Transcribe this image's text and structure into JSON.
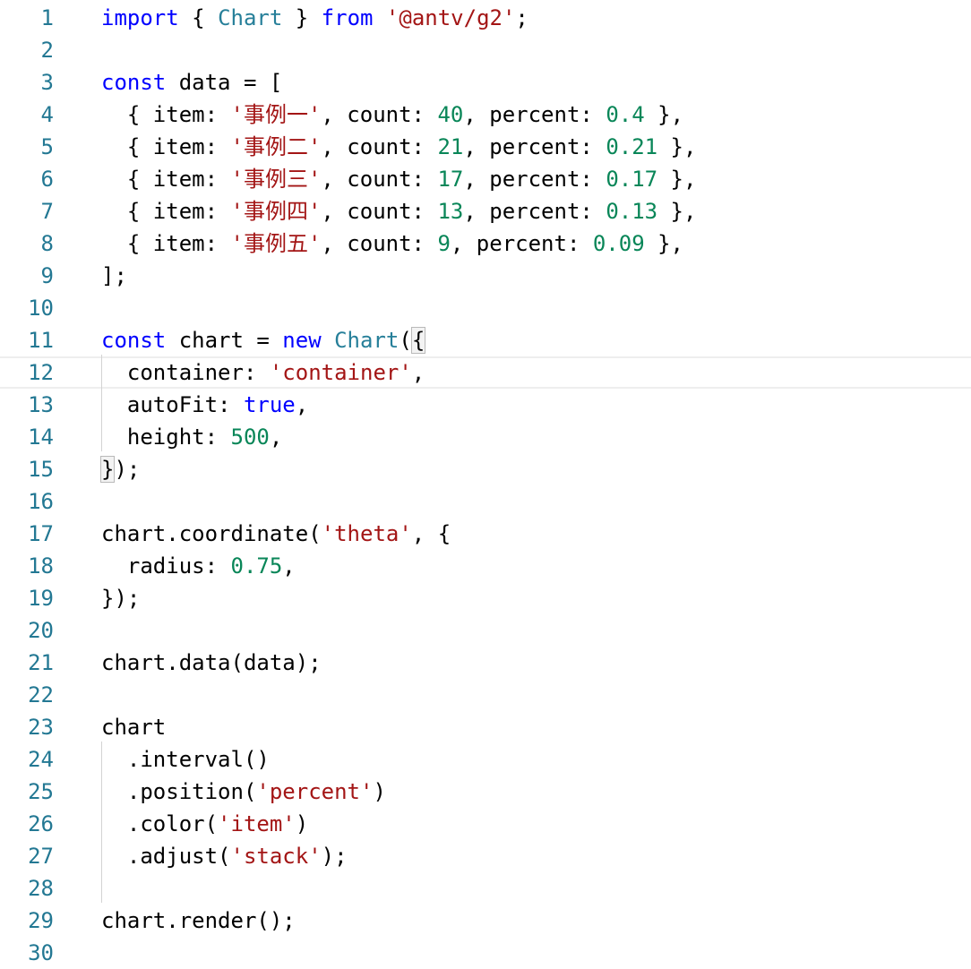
{
  "editor": {
    "lines": [
      {
        "n": "1",
        "tokens": [
          {
            "t": "import",
            "c": "kw"
          },
          {
            "t": " { ",
            "c": "df"
          },
          {
            "t": "Chart",
            "c": "ty"
          },
          {
            "t": " } ",
            "c": "df"
          },
          {
            "t": "from",
            "c": "kw"
          },
          {
            "t": " ",
            "c": "df"
          },
          {
            "t": "'@antv/g2'",
            "c": "st"
          },
          {
            "t": ";",
            "c": "df"
          }
        ]
      },
      {
        "n": "2",
        "tokens": []
      },
      {
        "n": "3",
        "tokens": [
          {
            "t": "const",
            "c": "kw"
          },
          {
            "t": " data = [",
            "c": "df"
          }
        ]
      },
      {
        "n": "4",
        "tokens": [
          {
            "t": "  { item: ",
            "c": "df"
          },
          {
            "t": "'事例一'",
            "c": "st"
          },
          {
            "t": ", count: ",
            "c": "df"
          },
          {
            "t": "40",
            "c": "nm"
          },
          {
            "t": ", percent: ",
            "c": "df"
          },
          {
            "t": "0.4",
            "c": "nm"
          },
          {
            "t": " },",
            "c": "df"
          }
        ]
      },
      {
        "n": "5",
        "tokens": [
          {
            "t": "  { item: ",
            "c": "df"
          },
          {
            "t": "'事例二'",
            "c": "st"
          },
          {
            "t": ", count: ",
            "c": "df"
          },
          {
            "t": "21",
            "c": "nm"
          },
          {
            "t": ", percent: ",
            "c": "df"
          },
          {
            "t": "0.21",
            "c": "nm"
          },
          {
            "t": " },",
            "c": "df"
          }
        ]
      },
      {
        "n": "6",
        "tokens": [
          {
            "t": "  { item: ",
            "c": "df"
          },
          {
            "t": "'事例三'",
            "c": "st"
          },
          {
            "t": ", count: ",
            "c": "df"
          },
          {
            "t": "17",
            "c": "nm"
          },
          {
            "t": ", percent: ",
            "c": "df"
          },
          {
            "t": "0.17",
            "c": "nm"
          },
          {
            "t": " },",
            "c": "df"
          }
        ]
      },
      {
        "n": "7",
        "tokens": [
          {
            "t": "  { item: ",
            "c": "df"
          },
          {
            "t": "'事例四'",
            "c": "st"
          },
          {
            "t": ", count: ",
            "c": "df"
          },
          {
            "t": "13",
            "c": "nm"
          },
          {
            "t": ", percent: ",
            "c": "df"
          },
          {
            "t": "0.13",
            "c": "nm"
          },
          {
            "t": " },",
            "c": "df"
          }
        ]
      },
      {
        "n": "8",
        "tokens": [
          {
            "t": "  { item: ",
            "c": "df"
          },
          {
            "t": "'事例五'",
            "c": "st"
          },
          {
            "t": ", count: ",
            "c": "df"
          },
          {
            "t": "9",
            "c": "nm"
          },
          {
            "t": ", percent: ",
            "c": "df"
          },
          {
            "t": "0.09",
            "c": "nm"
          },
          {
            "t": " },",
            "c": "df"
          }
        ]
      },
      {
        "n": "9",
        "tokens": [
          {
            "t": "];",
            "c": "df"
          }
        ]
      },
      {
        "n": "10",
        "tokens": []
      },
      {
        "n": "11",
        "tokens": [
          {
            "t": "const",
            "c": "kw"
          },
          {
            "t": " chart = ",
            "c": "df"
          },
          {
            "t": "new",
            "c": "kw"
          },
          {
            "t": " ",
            "c": "df"
          },
          {
            "t": "Chart",
            "c": "ty"
          },
          {
            "t": "(",
            "c": "df"
          },
          {
            "t": "{",
            "c": "df",
            "m": true
          }
        ]
      },
      {
        "n": "12",
        "tokens": [
          {
            "t": "  container: ",
            "c": "df"
          },
          {
            "t": "'container'",
            "c": "st"
          },
          {
            "t": ",",
            "c": "df"
          }
        ],
        "current": true
      },
      {
        "n": "13",
        "tokens": [
          {
            "t": "  autoFit: ",
            "c": "df"
          },
          {
            "t": "true",
            "c": "kw"
          },
          {
            "t": ",",
            "c": "df"
          }
        ]
      },
      {
        "n": "14",
        "tokens": [
          {
            "t": "  height: ",
            "c": "df"
          },
          {
            "t": "500",
            "c": "nm"
          },
          {
            "t": ",",
            "c": "df"
          }
        ]
      },
      {
        "n": "15",
        "tokens": [
          {
            "t": "}",
            "c": "df",
            "m": true
          },
          {
            "t": ");",
            "c": "df"
          }
        ]
      },
      {
        "n": "16",
        "tokens": []
      },
      {
        "n": "17",
        "tokens": [
          {
            "t": "chart.coordinate(",
            "c": "df"
          },
          {
            "t": "'theta'",
            "c": "st"
          },
          {
            "t": ", {",
            "c": "df"
          }
        ]
      },
      {
        "n": "18",
        "tokens": [
          {
            "t": "  radius: ",
            "c": "df"
          },
          {
            "t": "0.75",
            "c": "nm"
          },
          {
            "t": ",",
            "c": "df"
          }
        ]
      },
      {
        "n": "19",
        "tokens": [
          {
            "t": "});",
            "c": "df"
          }
        ]
      },
      {
        "n": "20",
        "tokens": []
      },
      {
        "n": "21",
        "tokens": [
          {
            "t": "chart.data(data);",
            "c": "df"
          }
        ]
      },
      {
        "n": "22",
        "tokens": []
      },
      {
        "n": "23",
        "tokens": [
          {
            "t": "chart",
            "c": "df"
          }
        ]
      },
      {
        "n": "24",
        "tokens": [
          {
            "t": "  .interval()",
            "c": "df"
          }
        ]
      },
      {
        "n": "25",
        "tokens": [
          {
            "t": "  .position(",
            "c": "df"
          },
          {
            "t": "'percent'",
            "c": "st"
          },
          {
            "t": ")",
            "c": "df"
          }
        ]
      },
      {
        "n": "26",
        "tokens": [
          {
            "t": "  .color(",
            "c": "df"
          },
          {
            "t": "'item'",
            "c": "st"
          },
          {
            "t": ")",
            "c": "df"
          }
        ]
      },
      {
        "n": "27",
        "tokens": [
          {
            "t": "  .adjust(",
            "c": "df"
          },
          {
            "t": "'stack'",
            "c": "st"
          },
          {
            "t": ");",
            "c": "df"
          }
        ]
      },
      {
        "n": "28",
        "tokens": []
      },
      {
        "n": "29",
        "tokens": [
          {
            "t": "chart.render();",
            "c": "df"
          }
        ]
      },
      {
        "n": "30",
        "tokens": []
      }
    ]
  }
}
